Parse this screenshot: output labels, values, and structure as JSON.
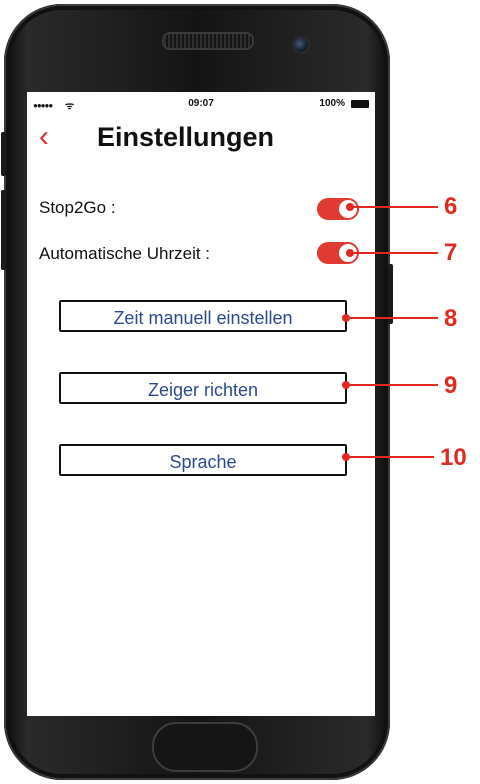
{
  "status_bar": {
    "signal": "●●●●●",
    "wifi": "ᯤ",
    "time": "09:07",
    "battery": "100%"
  },
  "header": {
    "back_icon": "‹",
    "title": "Einstellungen"
  },
  "settings": {
    "stop2go_label": "Stop2Go :",
    "stop2go_on": true,
    "auto_time_label": "Automatische Uhrzeit :",
    "auto_time_on": true
  },
  "buttons": {
    "manual_time": "Zeit manuell einstellen",
    "set_hands": "Zeiger richten",
    "language": "Sprache"
  },
  "callouts": [
    "6",
    "7",
    "8",
    "9",
    "10"
  ],
  "colors": {
    "accent": "#e03b32",
    "button_text": "#2e4a8e",
    "callout": "#e02a20"
  }
}
